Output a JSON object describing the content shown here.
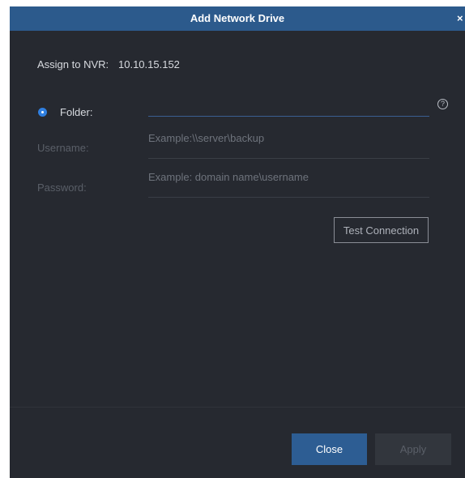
{
  "dialog": {
    "title": "Add Network Drive",
    "close_glyph": "×"
  },
  "assign": {
    "label": "Assign to NVR:",
    "value": "10.10.15.152"
  },
  "form": {
    "folder_label": "Folder:",
    "folder_value": "",
    "folder_selected": true,
    "help_glyph": "?",
    "username_label": "Username:",
    "username_placeholder": "Example:\\\\server\\backup",
    "password_label": "Password:",
    "password_placeholder": "Example: domain name\\username"
  },
  "buttons": {
    "test_connection": "Test Connection",
    "close": "Close",
    "apply": "Apply"
  },
  "colors": {
    "title_bar": "#2c5a8c",
    "dialog_bg": "#262930",
    "accent": "#2f7fe0",
    "primary_button": "#2d5d93"
  }
}
